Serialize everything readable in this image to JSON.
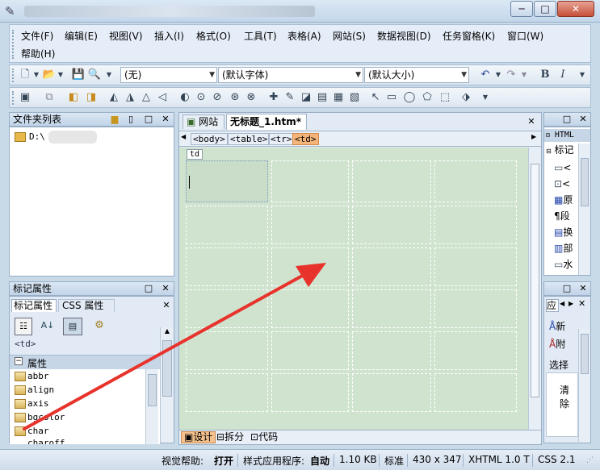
{
  "menu": {
    "items": [
      "文件(F)",
      "编辑(E)",
      "视图(V)",
      "插入(I)",
      "格式(O)",
      "工具(T)",
      "表格(A)",
      "网站(S)",
      "数据视图(D)",
      "任务窗格(K)",
      "窗口(W)"
    ],
    "help": "帮助(H)"
  },
  "toolbar": {
    "style_combo": "(无)",
    "font_combo": "(默认字体)",
    "size_combo": "(默认大小)",
    "bold": "B",
    "italic": "I"
  },
  "folder_panel": {
    "title": "文件夹列表",
    "root": "D:\\"
  },
  "tag_panel": {
    "title": "标记属性",
    "tab_tag": "标记属性",
    "tab_css": "CSS 属性",
    "current_tag": "<td>",
    "group": "属性",
    "attributes": [
      "abbr",
      "align",
      "axis",
      "bgcolor",
      "char",
      "charoff"
    ]
  },
  "editor": {
    "tab_site": "网站",
    "tab_doc": "无标题_1.htm*",
    "crumbs": [
      "<body>",
      "<table>",
      "<tr>",
      "<td>"
    ],
    "cell_label": "td",
    "view_design": "设计",
    "view_split": "拆分",
    "view_code": "代码"
  },
  "right_panel": {
    "toolbox_title": "HTML",
    "toolbox_section": "标记",
    "items": [
      "<",
      "<",
      "原",
      "段",
      "换",
      "部",
      "水"
    ],
    "apply_tab": "应",
    "apply_items": [
      "新",
      "附"
    ],
    "select_label": "选择",
    "clear_label": "清除"
  },
  "status": {
    "visual_aid_label": "视觉帮助:",
    "visual_aid_value": "打开",
    "style_app_label": "样式应用程序:",
    "style_app_value": "自动",
    "size": "1.10 KB",
    "mode": "标准",
    "dims": "430 x 347",
    "doctype": "XHTML 1.0 T",
    "css": "CSS 2.1"
  },
  "colors": {
    "canvas": "#cfe3cf",
    "arrow": "#e8332c",
    "active_crumb": "#f5b47a"
  }
}
